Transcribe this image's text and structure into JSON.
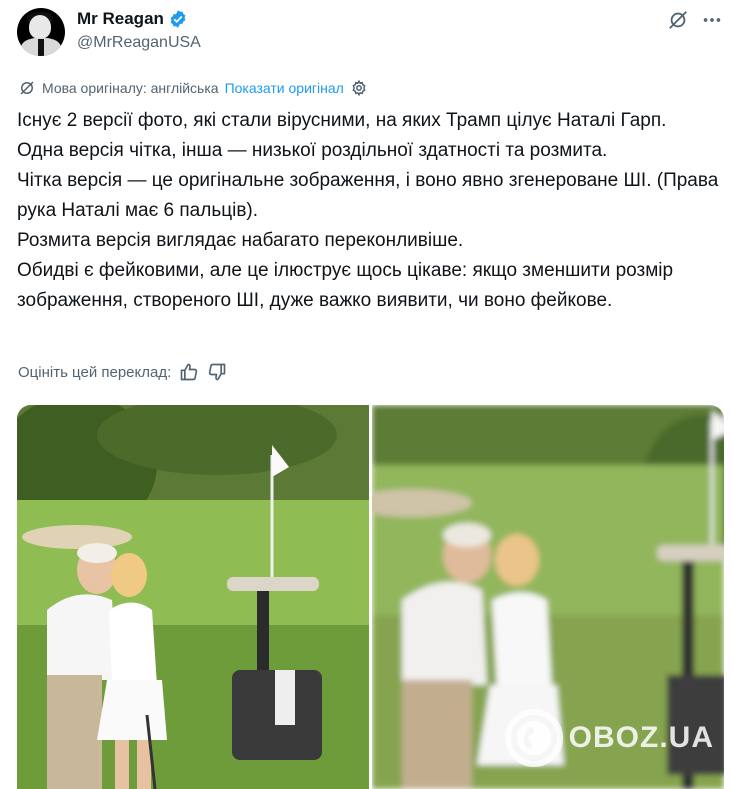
{
  "author": {
    "name": "Mr Reagan",
    "handle": "@MrReaganUSA"
  },
  "translation": {
    "original_language_label": "Мова оригіналу: англійська",
    "show_original_label": "Показати оригінал"
  },
  "tweet": {
    "lines": [
      "Існує 2 версії фото, які стали вірусними, на яких Трамп цілує Наталі Гарп.",
      "Одна версія чітка, інша — низької роздільної здатності та розмита.",
      "Чітка версія — це оригінальне зображення, і воно явно згенероване ШІ. (Права рука Наталі має 6 пальців).",
      "Розмита версія виглядає набагато переконливіше.",
      "Обидві є фейковими, але це ілюструє щось цікаве: якщо зменшити розмір зображення, створеного ШІ, дуже важко виявити, чи воно фейкове."
    ]
  },
  "rate_translation_label": "Оцініть цей переклад:",
  "watermark": "OBOZ.UA",
  "colors": {
    "accent": "#1d9bf0",
    "secondary_text": "#536471",
    "text": "#0f1419"
  },
  "icons": [
    "verified-badge-icon",
    "grok-icon",
    "more-icon",
    "translate-icon",
    "settings-icon",
    "thumbs-up-icon",
    "thumbs-down-icon"
  ]
}
